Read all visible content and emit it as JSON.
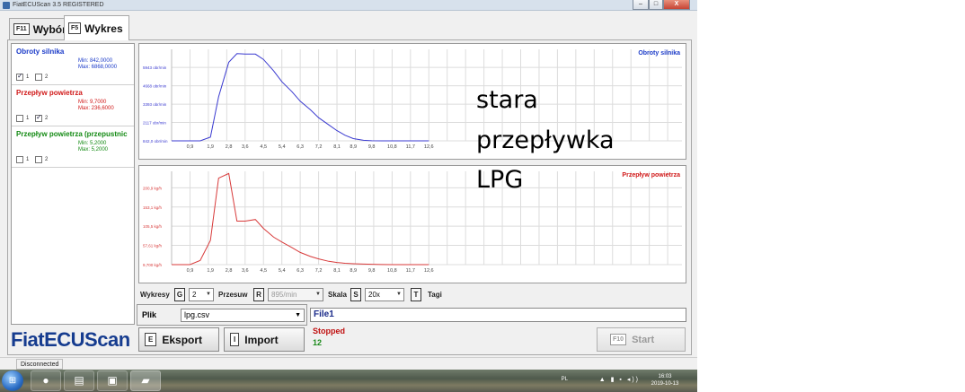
{
  "window": {
    "title": "FiatECUScan 3.5 REGISTERED",
    "minimize": "–",
    "maximize": "□",
    "close": "X"
  },
  "tabs": [
    {
      "key": "F11",
      "label": "Wybór",
      "active": false
    },
    {
      "key": "F5",
      "label": "Wykres",
      "active": true
    }
  ],
  "signals": [
    {
      "name": "Obroty silnika",
      "min": "Min: 842,0000",
      "max": "Max: 6868,0000",
      "color": "#1a3ac8",
      "check1": true,
      "check2": false,
      "check1_label": "1",
      "check2_label": "2"
    },
    {
      "name": "Przepływ powietrza",
      "min": "Min: 9,7000",
      "max": "Max: 236,6000",
      "color": "#d01818",
      "check1": false,
      "check2": true,
      "check1_label": "1",
      "check2_label": "2"
    },
    {
      "name": "Przepływ powietrza (przepustnic",
      "min": "Min: 5,2000",
      "max": "Max: 5,2000",
      "color": "#138a13",
      "check1": false,
      "check2": false,
      "check1_label": "1",
      "check2_label": "2"
    }
  ],
  "chart_data": [
    {
      "type": "line",
      "title": "Obroty silnika",
      "color": "#3a3ad0",
      "x": [
        0,
        0.5,
        0.9,
        1.4,
        1.9,
        2.3,
        2.8,
        3.2,
        3.6,
        4.1,
        4.5,
        5.0,
        5.4,
        5.9,
        6.3,
        6.8,
        7.2,
        7.7,
        8.1,
        8.5,
        8.9,
        9.4,
        9.8,
        10.3,
        10.8,
        11.2,
        11.7,
        12.2,
        12.6
      ],
      "y": [
        842,
        842,
        842,
        842,
        1100,
        3900,
        6300,
        6900,
        6868,
        6868,
        6500,
        5700,
        4950,
        4250,
        3600,
        3000,
        2450,
        1950,
        1550,
        1230,
        1000,
        880,
        850,
        842,
        842,
        842,
        842,
        842,
        842
      ],
      "x_ticks": [
        "0,9",
        "1,9",
        "2,8",
        "3,6",
        "4,5",
        "5,4",
        "6,3",
        "7,2",
        "8,1",
        "8,9",
        "9,8",
        "10,8",
        "11,7",
        "12,6"
      ],
      "x_tick_values": [
        0.9,
        1.9,
        2.8,
        3.6,
        4.5,
        5.4,
        6.3,
        7.2,
        8.1,
        8.9,
        9.8,
        10.8,
        11.7,
        12.6
      ],
      "y_ticks": [
        "842,0 obr/min",
        "2117 obr/min",
        "3393 obr/min",
        "4668 obr/min",
        "5943 obr/min"
      ],
      "y_tick_values": [
        842,
        2117,
        3393,
        4668,
        5943
      ],
      "xlim": [
        0,
        25
      ],
      "ylim": [
        842,
        7200
      ],
      "grid": true,
      "legend": "top-right"
    },
    {
      "type": "line",
      "title": "Przepływ powietrza",
      "color": "#d83a3a",
      "x": [
        0,
        0.5,
        0.9,
        1.4,
        1.9,
        2.3,
        2.8,
        3.2,
        3.6,
        4.1,
        4.5,
        5.0,
        5.4,
        5.9,
        6.3,
        6.8,
        7.2,
        7.7,
        8.1,
        8.5,
        8.9,
        9.4,
        9.8,
        10.3,
        10.8,
        11.2,
        11.7,
        12.2,
        12.6
      ],
      "y": [
        9.7,
        9.7,
        9.7,
        20,
        70,
        225,
        236.6,
        118,
        118,
        122,
        100,
        78,
        66,
        52,
        40,
        30,
        24,
        18,
        15,
        13,
        12,
        11,
        10.5,
        10,
        9.7,
        9.7,
        9.7,
        9.7,
        9.7
      ],
      "x_ticks": [
        "0,9",
        "1,9",
        "2,8",
        "3,6",
        "4,5",
        "5,4",
        "6,3",
        "7,2",
        "8,1",
        "8,9",
        "9,8",
        "10,8",
        "11,7",
        "12,6"
      ],
      "x_tick_values": [
        0.9,
        1.9,
        2.8,
        3.6,
        4.5,
        5.4,
        6.3,
        7.2,
        8.1,
        8.9,
        9.8,
        10.8,
        11.7,
        12.6
      ],
      "y_ticks": [
        "9,700 kg/h",
        "57,61 kg/h",
        "105,5 kg/h",
        "153,1 kg/h",
        "200,9 kg/h"
      ],
      "y_tick_values": [
        9.7,
        57.61,
        105.5,
        153.1,
        200.9
      ],
      "xlim": [
        0,
        25
      ],
      "ylim": [
        9.7,
        242
      ],
      "grid": true,
      "legend": "top-right"
    }
  ],
  "note": {
    "line1": "stara",
    "line2": "przepływka",
    "line3": "LPG"
  },
  "controls": {
    "wykresy_label": "Wykresy",
    "wykresy_key": "G",
    "wykresy_value": "2",
    "przesuw_label": "Przesuw",
    "przesuw_key": "R",
    "przesuw_value": "895/min",
    "skala_label": "Skala",
    "skala_key": "S",
    "skala_value": "20x",
    "tagi_key": "T",
    "tagi_label": "Tagi"
  },
  "file": {
    "plik_label": "Plik",
    "plik_value": "lpg.csv",
    "eksport_key": "E",
    "eksport_label": "Eksport",
    "import_key": "I",
    "import_label": "Import",
    "name": "File1",
    "status": "Stopped",
    "count": "12",
    "start_key": "F10",
    "start_label": "Start"
  },
  "logo": "FiatECUScan",
  "statusbar": {
    "connection": "Disconnected"
  },
  "taskbar": {
    "lang": "PL",
    "time": "16:03",
    "date": "2019-10-13"
  }
}
